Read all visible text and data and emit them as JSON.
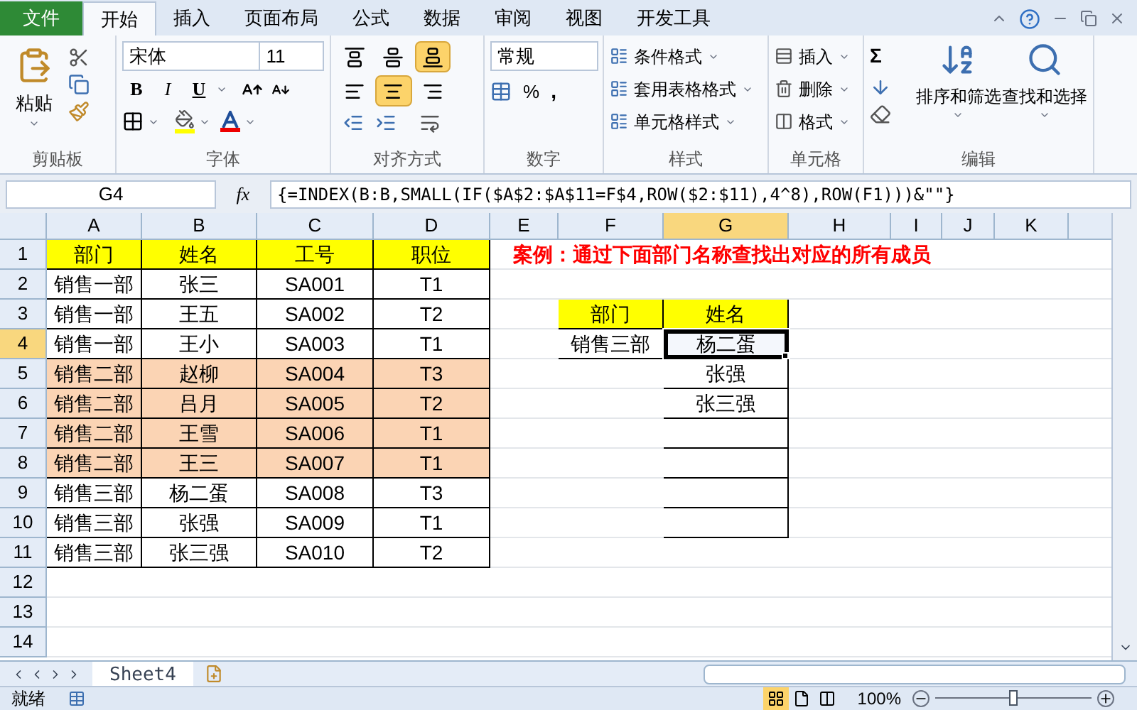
{
  "ribbon_tabs": [
    {
      "label": "文件",
      "kind": "file",
      "selected": false
    },
    {
      "label": "开始",
      "kind": "tab",
      "selected": true
    },
    {
      "label": "插入",
      "kind": "tab",
      "selected": false
    },
    {
      "label": "页面布局",
      "kind": "tab",
      "selected": false
    },
    {
      "label": "公式",
      "kind": "tab",
      "selected": false
    },
    {
      "label": "数据",
      "kind": "tab",
      "selected": false
    },
    {
      "label": "审阅",
      "kind": "tab",
      "selected": false
    },
    {
      "label": "视图",
      "kind": "tab",
      "selected": false
    },
    {
      "label": "开发工具",
      "kind": "tab",
      "selected": false
    }
  ],
  "clipboard": {
    "paste": "粘贴",
    "label": "剪贴板"
  },
  "font": {
    "name": "宋体",
    "size": "11",
    "bold": "B",
    "italic": "I",
    "underline": "U",
    "label": "字体"
  },
  "alignment": {
    "buttons": [
      {
        "selected": false
      },
      {
        "selected": false
      },
      {
        "selected": true
      },
      {
        "selected": false
      },
      {
        "selected": true
      },
      {
        "selected": false
      }
    ],
    "label": "对齐方式"
  },
  "number": {
    "format": "常规",
    "percent": "%",
    "comma": ",",
    "label": "数字"
  },
  "styles": {
    "items": [
      "条件格式",
      "套用表格格式",
      "单元格样式"
    ],
    "label": "样式"
  },
  "cells_group": {
    "items": [
      "插入",
      "删除",
      "格式"
    ],
    "label": "单元格"
  },
  "editing": {
    "sum": "Σ",
    "buttons": [
      "排序和筛选",
      "查找和选择"
    ],
    "label": "编辑"
  },
  "formula_bar": {
    "cell_ref": "G4",
    "fx": "fx",
    "formula": "{=INDEX(B:B,SMALL(IF($A$2:$A$11=F$4,ROW($2:$11),4^8),ROW(F1)))&\"\"}"
  },
  "columns": [
    {
      "label": "A",
      "selected": false
    },
    {
      "label": "B",
      "selected": false
    },
    {
      "label": "C",
      "selected": false
    },
    {
      "label": "D",
      "selected": false
    },
    {
      "label": "E",
      "selected": false
    },
    {
      "label": "F",
      "selected": false
    },
    {
      "label": "G",
      "selected": true
    },
    {
      "label": "H",
      "selected": false
    },
    {
      "label": "I",
      "selected": false
    },
    {
      "label": "J",
      "selected": false
    },
    {
      "label": "K",
      "selected": false
    }
  ],
  "row_headers": [
    {
      "number": "1",
      "selected": false
    },
    {
      "number": "2",
      "selected": false
    },
    {
      "number": "3",
      "selected": false
    },
    {
      "number": "4",
      "selected": true
    },
    {
      "number": "5",
      "selected": false
    },
    {
      "number": "6",
      "selected": false
    },
    {
      "number": "7",
      "selected": false
    },
    {
      "number": "8",
      "selected": false
    },
    {
      "number": "9",
      "selected": false
    },
    {
      "number": "10",
      "selected": false
    },
    {
      "number": "11",
      "selected": false
    },
    {
      "number": "12",
      "selected": false
    },
    {
      "number": "13",
      "selected": false
    },
    {
      "number": "14",
      "selected": false
    }
  ],
  "main_table": [
    {
      "cells": [
        "部门",
        "姓名",
        "工号",
        "职位"
      ],
      "color": "#ffff00"
    },
    {
      "cells": [
        "销售一部",
        "张三",
        "SA001",
        "T1"
      ]
    },
    {
      "cells": [
        "销售一部",
        "王五",
        "SA002",
        "T2"
      ]
    },
    {
      "cells": [
        "销售一部",
        "王小",
        "SA003",
        "T1"
      ]
    },
    {
      "cells": [
        "销售二部",
        "赵柳",
        "SA004",
        "T3"
      ],
      "color": "#fbd4b4"
    },
    {
      "cells": [
        "销售二部",
        "吕月",
        "SA005",
        "T2"
      ],
      "color": "#fbd4b4"
    },
    {
      "cells": [
        "销售二部",
        "王雪",
        "SA006",
        "T1"
      ],
      "color": "#fbd4b4"
    },
    {
      "cells": [
        "销售二部",
        "王三",
        "SA007",
        "T1"
      ],
      "color": "#fbd4b4"
    },
    {
      "cells": [
        "销售三部",
        "杨二蛋",
        "SA008",
        "T3"
      ]
    },
    {
      "cells": [
        "销售三部",
        "张强",
        "SA009",
        "T1"
      ]
    },
    {
      "cells": [
        "销售三部",
        "张三强",
        "SA010",
        "T2"
      ]
    }
  ],
  "note": "案例：通过下面部门名称查找出对应的所有成员",
  "lookup_table": {
    "headers": [
      "部门",
      "姓名"
    ],
    "department": "销售三部",
    "results": [
      {
        "name": "杨二蛋",
        "selected": true
      },
      {
        "name": "张强",
        "selected": false
      },
      {
        "name": "张三强",
        "selected": false
      },
      {
        "selected": false
      },
      {
        "selected": false
      },
      {
        "selected": false
      },
      {
        "selected": false
      }
    ]
  },
  "sheet_tabs": [
    {
      "label": "Sheet4",
      "selected": true
    }
  ],
  "status_bar": {
    "status": "就绪",
    "views": [
      {
        "selected": true
      },
      {
        "selected": false
      },
      {
        "selected": false
      }
    ],
    "zoom": "100%",
    "zoom_slider": {
      "level": 0.5
    }
  }
}
